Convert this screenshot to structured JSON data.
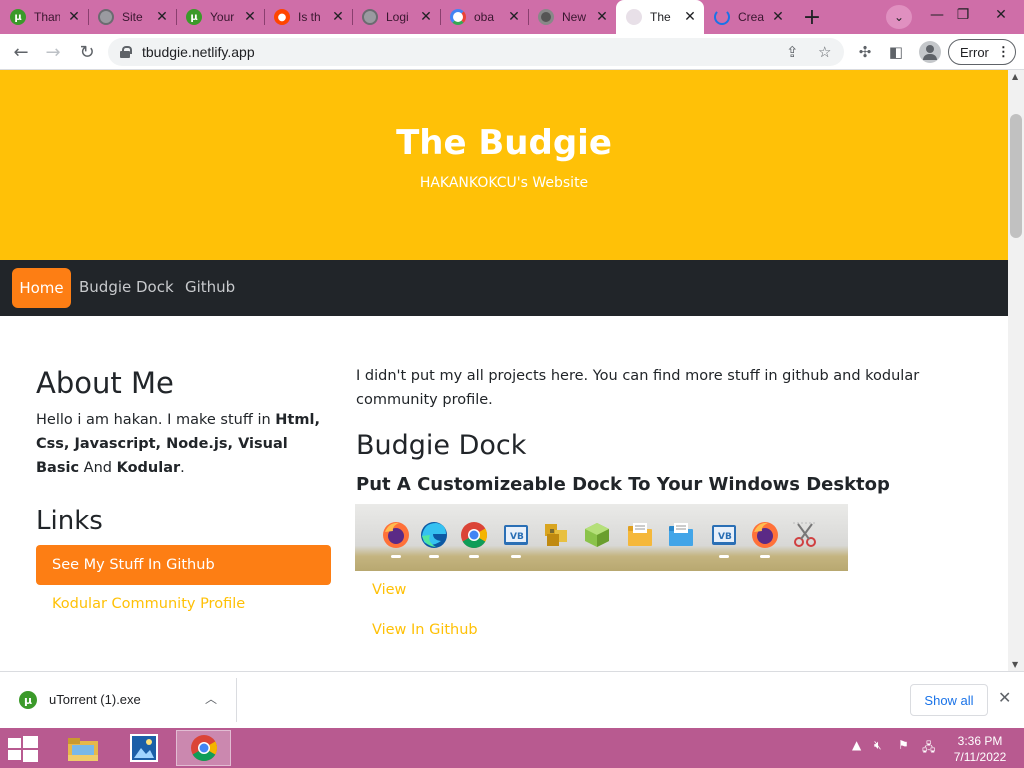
{
  "browser": {
    "tabs": [
      {
        "title": "Thank",
        "favicon": "utorrent-icon",
        "active": false
      },
      {
        "title": "Site",
        "favicon": "globe-icon",
        "active": false
      },
      {
        "title": "Your",
        "favicon": "utorrent-icon",
        "active": false
      },
      {
        "title": "Is th",
        "favicon": "reddit-icon",
        "active": false
      },
      {
        "title": "Logi",
        "favicon": "globe-icon",
        "active": false
      },
      {
        "title": "oba",
        "favicon": "google-icon",
        "active": false
      },
      {
        "title": "New",
        "favicon": "chrome-icon",
        "active": false
      },
      {
        "title": "The",
        "favicon": "budgie-icon",
        "active": true
      },
      {
        "title": "Crea",
        "favicon": "loading-icon",
        "active": false
      }
    ],
    "new_tab_glyph": "+",
    "url": "tbudgie.netlify.app",
    "error_label": "Error",
    "tab_color": "#cf6ea8"
  },
  "site": {
    "title": "The Budgie",
    "subtitle": "HAKANKOKCU's Website",
    "nav": {
      "home": "Home",
      "dock": "Budgie Dock",
      "github": "Github"
    },
    "about": {
      "title": "About Me",
      "text_1": "Hello i am hakan. I make stuff in ",
      "bold_1": "Html, Css, Javascript, Node.js, Visual Basic",
      "text_2": " And ",
      "bold_2": "Kodular",
      "text_3": "."
    },
    "links": {
      "title": "Links",
      "github_button": "See My Stuff In Github",
      "kodular_link": "Kodular Community Profile"
    },
    "intro": "I didn't put my all projects here. You can find more stuff in github and kodular community profile.",
    "dock": {
      "title": "Budgie Dock",
      "subtitle": "Put A Customizeable Dock To Your Windows Desktop",
      "icons": [
        "firefox-icon",
        "edge-icon",
        "chrome-icon",
        "vb-icon",
        "archive-icon",
        "cube-icon",
        "folder-icon",
        "folder-icon",
        "vb-icon",
        "firefox-icon",
        "snipping-tool-icon"
      ],
      "view_link": "View",
      "github_link": "View In Github"
    },
    "colors": {
      "primary": "#ffc107",
      "accent": "#fd7e14",
      "nav_dark": "#212529"
    }
  },
  "download_bar": {
    "filename": "uTorrent (1).exe",
    "show_all": "Show all"
  },
  "taskbar": {
    "apps": [
      "file-explorer-icon",
      "photo-app-icon",
      "chrome-icon"
    ],
    "time": "3:36 PM",
    "date": "7/11/2022"
  }
}
